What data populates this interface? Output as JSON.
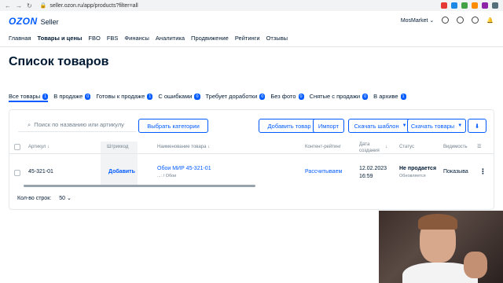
{
  "browser": {
    "url": "seller.ozon.ru/app/products?filter=all"
  },
  "header": {
    "logo": "OZON",
    "logo_sub": "Seller",
    "company": "MosMarket"
  },
  "mainnav": [
    "Главная",
    "Товары и цены",
    "FBO",
    "FBS",
    "Финансы",
    "Аналитика",
    "Продвижение",
    "Рейтинги",
    "Отзывы"
  ],
  "page": {
    "title": "Список товаров"
  },
  "tabs": [
    {
      "label": "Все товары",
      "count": "1"
    },
    {
      "label": "В продаже",
      "count": "0"
    },
    {
      "label": "Готовы к продаже",
      "count": "1"
    },
    {
      "label": "С ошибками",
      "count": "0"
    },
    {
      "label": "Требует доработки",
      "count": "0"
    },
    {
      "label": "Без фото",
      "count": "0"
    },
    {
      "label": "Снятые с продажи",
      "count": "0"
    },
    {
      "label": "В архиве",
      "count": "1"
    }
  ],
  "toolbar": {
    "search_placeholder": "Поиск по названию или артикулу",
    "select_categories": "Выбрать категории",
    "add_product": "Добавить товар",
    "import": "Импорт",
    "download_template": "Скачать шаблон",
    "download_products": "Скачать товары"
  },
  "table": {
    "headers": {
      "sku": "Артикул",
      "barcode": "Штрихкод",
      "name": "Наименование товара",
      "content_rating": "Контент-рейтинг",
      "created_label_1": "Дата",
      "created_label_2": "создания",
      "status": "Статус",
      "visibility": "Видимость"
    },
    "row": {
      "sku": "45-321-01",
      "barcode_action": "Добавить",
      "name": "Обои МИР 45-321-01",
      "category": "...: / Обои",
      "content_rating": "Рассчитываем",
      "date": "12.02.2023",
      "time": "16:59",
      "status": "Не продается",
      "status_sub": "Обновляется",
      "visibility": "Показыва"
    }
  },
  "footer": {
    "rows_label": "Кол-во строк:",
    "rows_value": "50"
  }
}
